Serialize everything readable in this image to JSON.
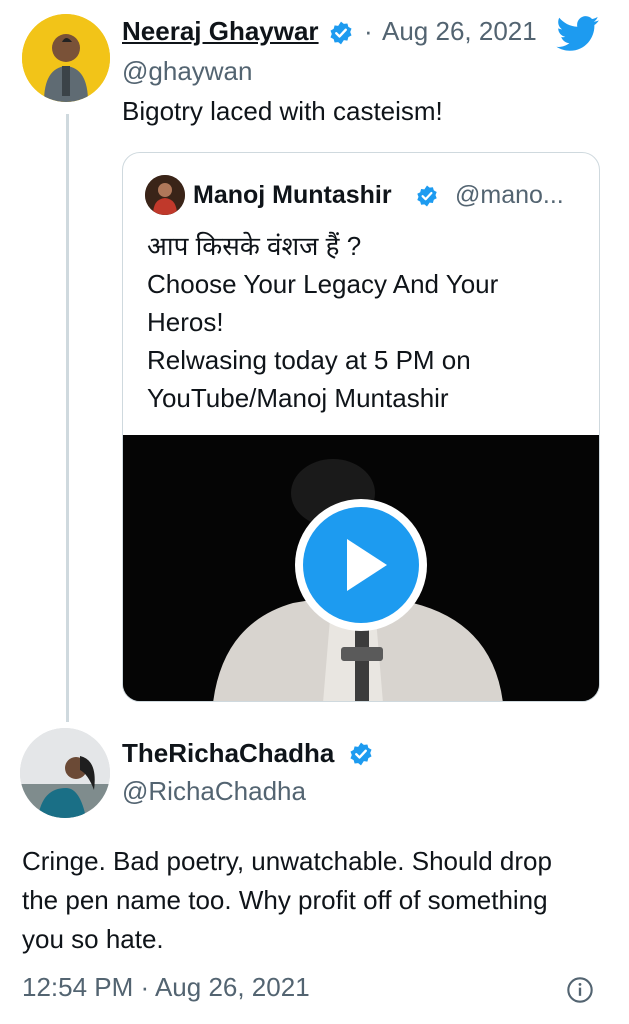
{
  "colors": {
    "brand_blue": "#1d9bf0",
    "text_primary": "#0f1419",
    "text_secondary": "#536471",
    "border": "#cfd9de"
  },
  "tweet": {
    "author_name": "Neeraj Ghaywar",
    "author_handle": "@ghaywan",
    "separator": "·",
    "date": "Aug 26, 2021",
    "body": "Bigotry laced with casteism!",
    "icons": [
      "verified-badge-icon",
      "twitter-bird-icon"
    ]
  },
  "quoted_tweet": {
    "author_name": "Manoj Muntashir",
    "author_handle": "@mano...",
    "lines": [
      "आप किसके वंशज हैं ?",
      "Choose Your Legacy And Your",
      "Heros!",
      "Relwasing today at 5 PM on",
      "YouTube/Manoj Muntashir"
    ],
    "media": "video",
    "icons": [
      "verified-badge-icon",
      "play-icon"
    ]
  },
  "reply": {
    "author_name": "TheRichaChadha",
    "author_handle": "@RichaChadha",
    "lines": [
      "Cringe. Bad poetry, unwatchable. Should drop",
      "the pen name too. Why profit off of something",
      "you so hate."
    ],
    "timestamp": "12:54 PM · Aug 26, 2021",
    "icons": [
      "verified-badge-icon",
      "info-icon"
    ]
  }
}
